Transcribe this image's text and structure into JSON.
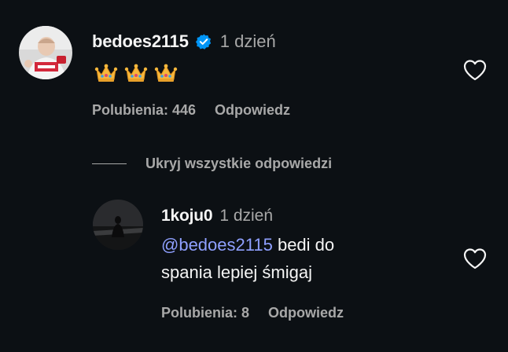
{
  "comment": {
    "username": "bedoes2115",
    "verified": true,
    "time": "1 dzień",
    "emojis": [
      "crown-emoji",
      "crown-emoji",
      "crown-emoji"
    ],
    "likes_label": "Polubienia: 446",
    "reply_label": "Odpowiedz"
  },
  "hide_replies_label": "Ukryj wszystkie odpowiedzi",
  "reply": {
    "username": "1koju0",
    "time": "1 dzień",
    "mention": "@bedoes2115",
    "text_line1": "bedi do",
    "text_line2": "spania lepiej śmigaj",
    "likes_label": "Polubienia: 8",
    "reply_label": "Odpowiedz"
  },
  "icons": {
    "verified": "verified-badge-icon",
    "like": "heart-outline-icon"
  },
  "colors": {
    "background": "#0c1014",
    "text_primary": "#f5f5f5",
    "text_secondary": "#a8a8a8",
    "verified_blue": "#0095f6",
    "mention": "#8fa0ff"
  }
}
